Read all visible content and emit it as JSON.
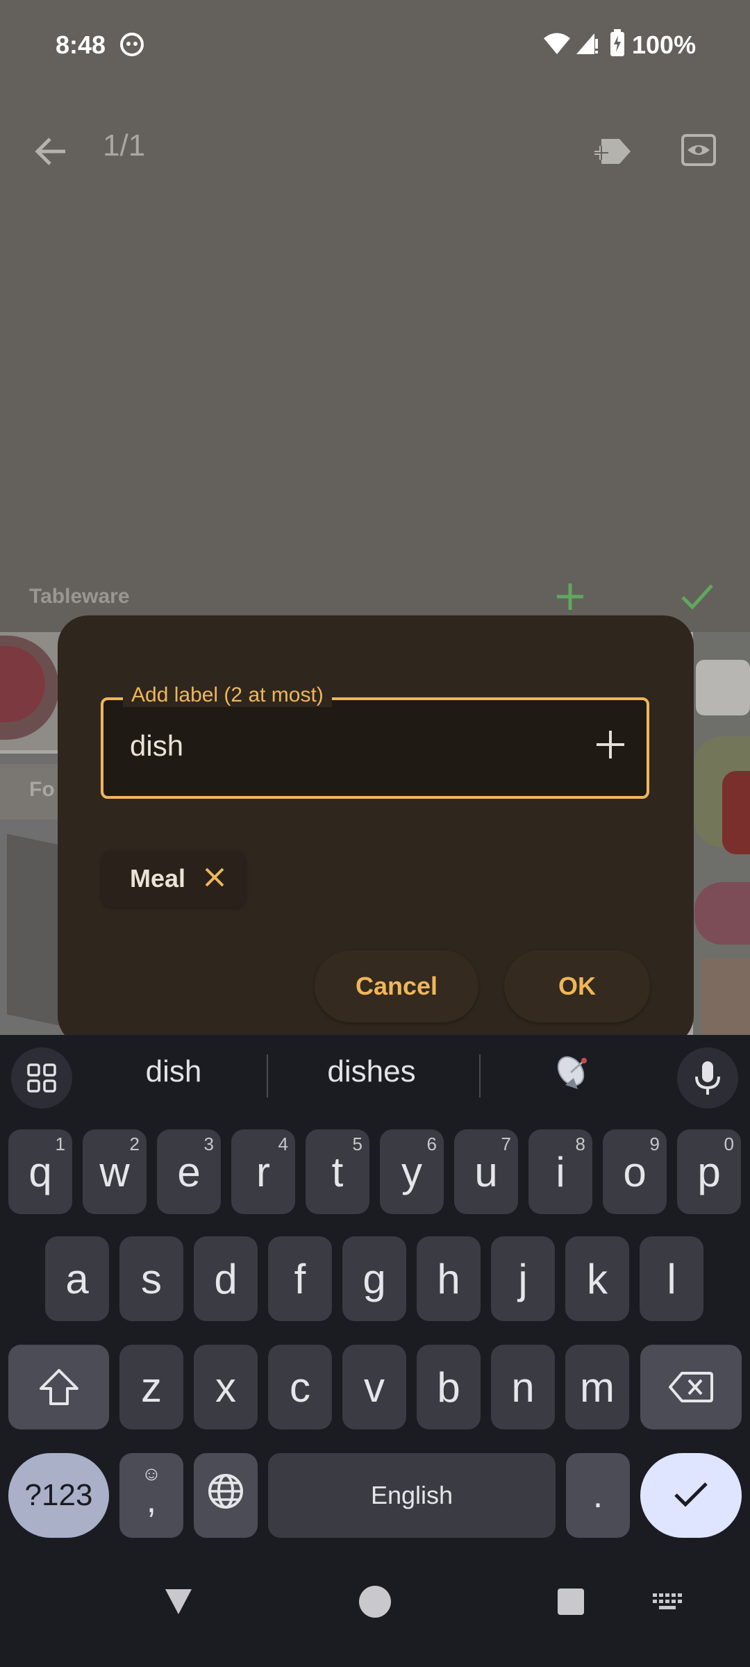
{
  "status_bar": {
    "time": "8:48",
    "battery": "100%"
  },
  "toolbar": {
    "page_counter": "1/1"
  },
  "label_section": {
    "title": "Tableware",
    "partial_label": "Fo"
  },
  "dialog": {
    "field_label": "Add label (2 at most)",
    "field_value": "dish",
    "chips": [
      {
        "label": "Meal"
      }
    ],
    "cancel": "Cancel",
    "ok": "OK"
  },
  "keyboard": {
    "suggestions": [
      "dish",
      "dishes"
    ],
    "row1": [
      {
        "k": "q",
        "h": "1"
      },
      {
        "k": "w",
        "h": "2"
      },
      {
        "k": "e",
        "h": "3"
      },
      {
        "k": "r",
        "h": "4"
      },
      {
        "k": "t",
        "h": "5"
      },
      {
        "k": "y",
        "h": "6"
      },
      {
        "k": "u",
        "h": "7"
      },
      {
        "k": "i",
        "h": "8"
      },
      {
        "k": "o",
        "h": "9"
      },
      {
        "k": "p",
        "h": "0"
      }
    ],
    "row2": [
      "a",
      "s",
      "d",
      "f",
      "g",
      "h",
      "j",
      "k",
      "l"
    ],
    "row3": [
      "z",
      "x",
      "c",
      "v",
      "b",
      "n",
      "m"
    ],
    "symbols_key": "?123",
    "comma_key": ",",
    "space_key": "English",
    "period_key": "."
  },
  "colors": {
    "accent": "#f0b65a",
    "green": "#5fa85d",
    "dialog_bg": "#2f271e",
    "keyboard_bg": "#1b1c22",
    "enter_key_bg": "#dfe5ff",
    "symbols_key_bg": "#a9b0c8"
  }
}
